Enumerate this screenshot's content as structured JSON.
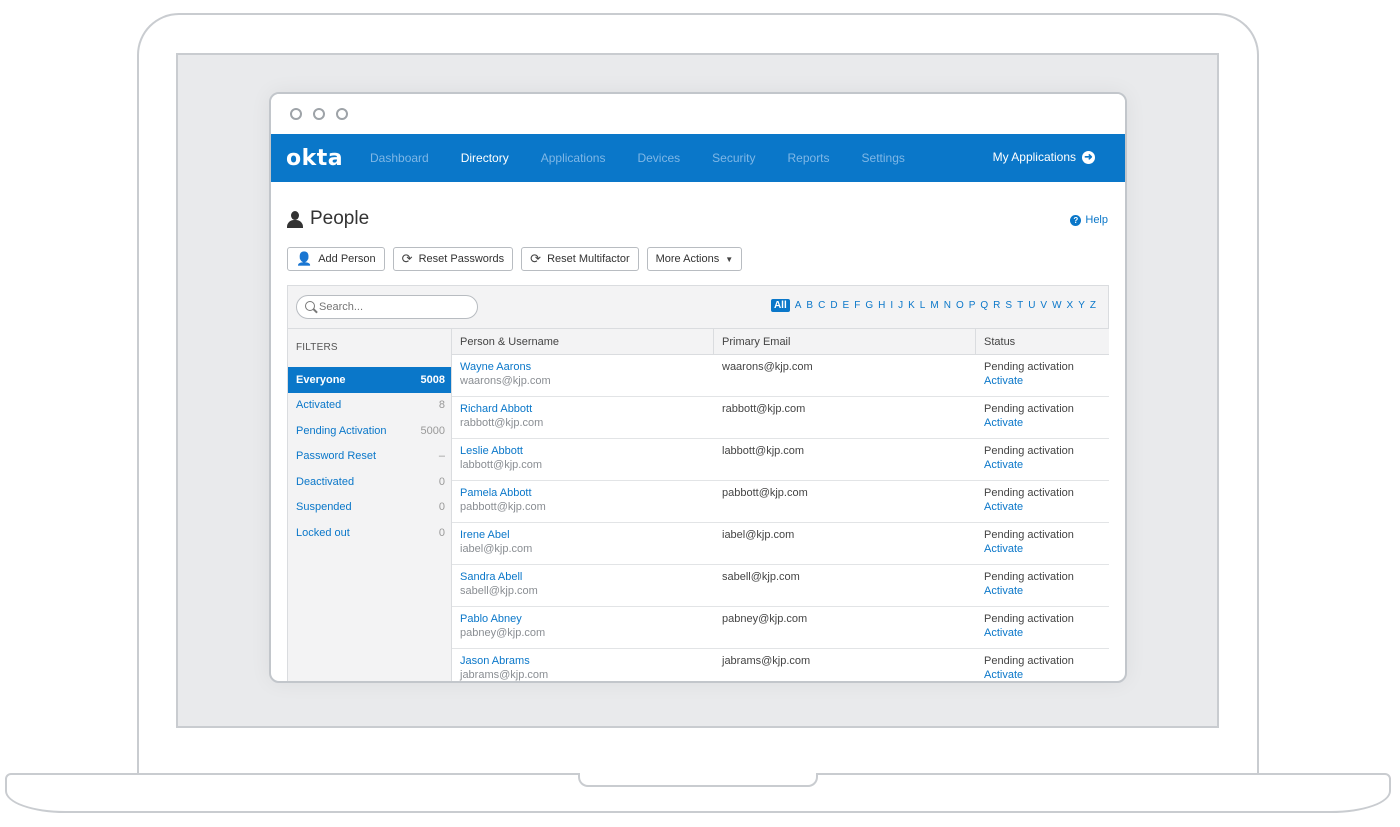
{
  "nav": {
    "logo": "okta",
    "items": [
      {
        "label": "Dashboard",
        "active": false
      },
      {
        "label": "Directory",
        "active": true
      },
      {
        "label": "Applications",
        "active": false
      },
      {
        "label": "Devices",
        "active": false
      },
      {
        "label": "Security",
        "active": false
      },
      {
        "label": "Reports",
        "active": false
      },
      {
        "label": "Settings",
        "active": false
      }
    ],
    "my_apps": "My Applications"
  },
  "page": {
    "title": "People",
    "help": "Help"
  },
  "toolbar": {
    "add_person": "Add Person",
    "reset_passwords": "Reset Passwords",
    "reset_multifactor": "Reset Multifactor",
    "more_actions": "More Actions"
  },
  "search": {
    "placeholder": "Search..."
  },
  "alphabet": [
    "All",
    "A",
    "B",
    "C",
    "D",
    "E",
    "F",
    "G",
    "H",
    "I",
    "J",
    "K",
    "L",
    "M",
    "N",
    "O",
    "P",
    "Q",
    "R",
    "S",
    "T",
    "U",
    "V",
    "W",
    "X",
    "Y",
    "Z"
  ],
  "filters": {
    "heading": "FILTERS",
    "items": [
      {
        "label": "Everyone",
        "count": "5008",
        "selected": true
      },
      {
        "label": "Activated",
        "count": "8",
        "selected": false
      },
      {
        "label": "Pending Activation",
        "count": "5000",
        "selected": false
      },
      {
        "label": "Password Reset",
        "count": "–",
        "selected": false
      },
      {
        "label": "Deactivated",
        "count": "0",
        "selected": false
      },
      {
        "label": "Suspended",
        "count": "0",
        "selected": false
      },
      {
        "label": "Locked out",
        "count": "0",
        "selected": false
      }
    ]
  },
  "table": {
    "columns": [
      "Person & Username",
      "Primary Email",
      "Status"
    ],
    "rows": [
      {
        "name": "Wayne Aarons",
        "username": "waarons@kjp.com",
        "email": "waarons@kjp.com",
        "status": "Pending activation",
        "action": "Activate"
      },
      {
        "name": "Richard Abbott",
        "username": "rabbott@kjp.com",
        "email": "rabbott@kjp.com",
        "status": "Pending activation",
        "action": "Activate"
      },
      {
        "name": "Leslie Abbott",
        "username": "labbott@kjp.com",
        "email": "labbott@kjp.com",
        "status": "Pending activation",
        "action": "Activate"
      },
      {
        "name": "Pamela Abbott",
        "username": "pabbott@kjp.com",
        "email": "pabbott@kjp.com",
        "status": "Pending activation",
        "action": "Activate"
      },
      {
        "name": "Irene Abel",
        "username": "iabel@kjp.com",
        "email": "iabel@kjp.com",
        "status": "Pending activation",
        "action": "Activate"
      },
      {
        "name": "Sandra Abell",
        "username": "sabell@kjp.com",
        "email": "sabell@kjp.com",
        "status": "Pending activation",
        "action": "Activate"
      },
      {
        "name": "Pablo Abney",
        "username": "pabney@kjp.com",
        "email": "pabney@kjp.com",
        "status": "Pending activation",
        "action": "Activate"
      },
      {
        "name": "Jason Abrams",
        "username": "jabrams@kjp.com",
        "email": "jabrams@kjp.com",
        "status": "Pending activation",
        "action": "Activate"
      }
    ]
  },
  "colors": {
    "brand": "#0a77c9",
    "nav_inactive": "#7fb7e6"
  }
}
